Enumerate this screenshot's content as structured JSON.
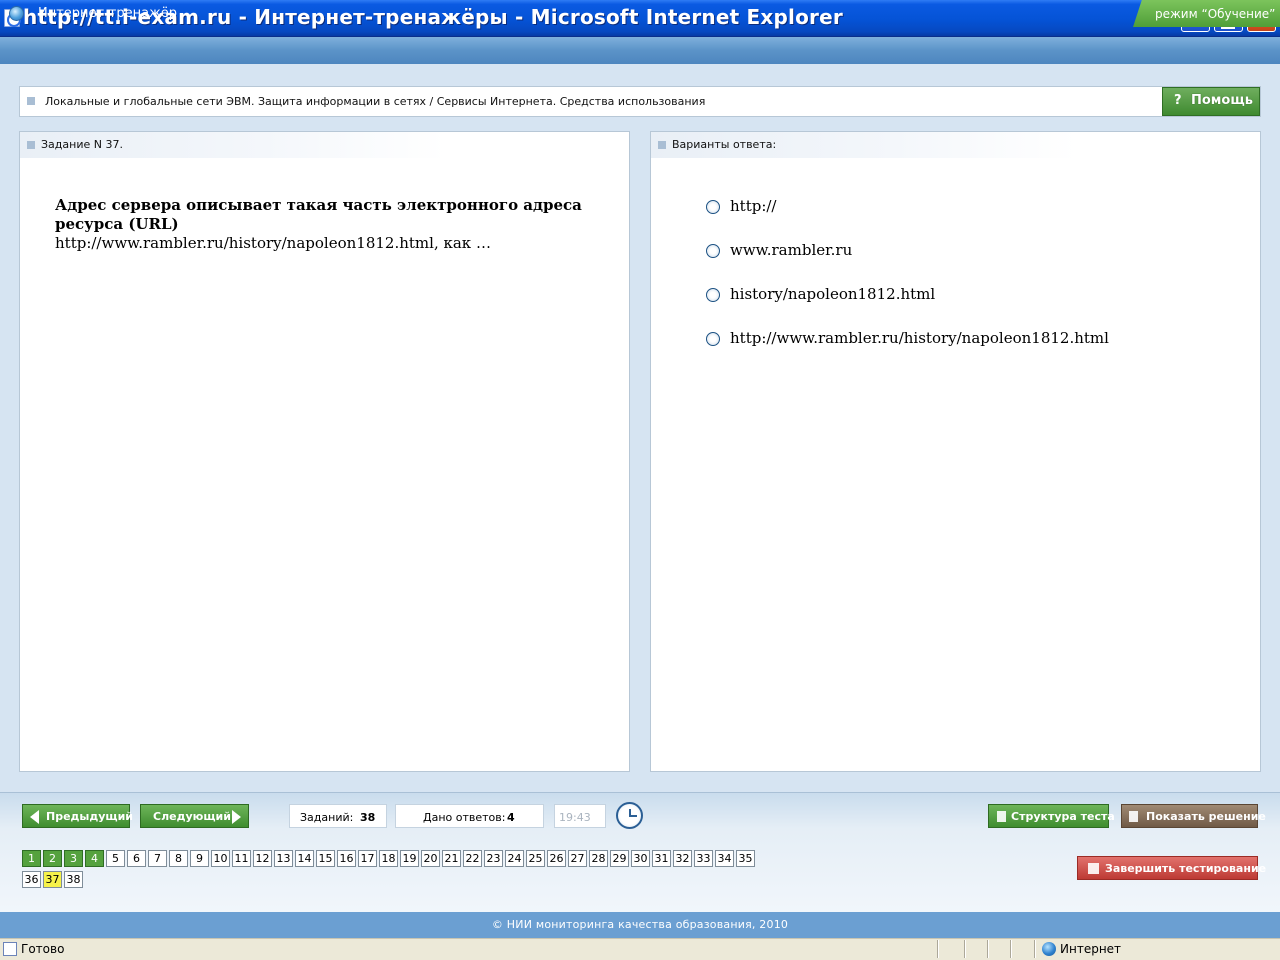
{
  "window": {
    "title": "http://tt.i-exam.ru - Интернет-тренажёры - Microsoft Internet Explorer"
  },
  "header": {
    "app_name": "Интернет-тренажёр",
    "mode": "режим “Обучение”"
  },
  "topic": {
    "text": "Локальные и глобальные сети ЭВМ. Защита информации в сетях / Сервисы Интернета. Средства использования",
    "help_label": "Помощь",
    "help_icon": "?"
  },
  "task": {
    "title": "Задание N 37.",
    "question_line1": "Адрес сервера описывает такая часть электронного адреса ресурса (URL)",
    "question_line2": "http://www.rambler.ru/history/napoleon1812.html, как …"
  },
  "answers": {
    "title": "Варианты ответа:",
    "options": [
      "http://",
      "www.rambler.ru",
      "history/napoleon1812.html",
      "http://www.rambler.ru/history/napoleon1812.html"
    ]
  },
  "controls": {
    "prev_label": "Предыдущий",
    "next_label": "Следующий",
    "tasks_label": "Заданий:",
    "tasks_count": "38",
    "answered_label": "Дано ответов:",
    "answered_count": "4",
    "timer": "19:43",
    "structure_label": "Структура теста",
    "solution_label": "Показать решение",
    "finish_label": "Завершить тестирование"
  },
  "question_numbers": {
    "items": [
      "1",
      "2",
      "3",
      "4",
      "5",
      "6",
      "7",
      "8",
      "9",
      "10",
      "11",
      "12",
      "13",
      "14",
      "15",
      "16",
      "17",
      "18",
      "19",
      "20",
      "21",
      "22",
      "23",
      "24",
      "25",
      "26",
      "27",
      "28",
      "29",
      "30",
      "31",
      "32",
      "33",
      "34",
      "35",
      "36",
      "37",
      "38"
    ],
    "answered": [
      "1",
      "2",
      "3",
      "4"
    ],
    "current": "37"
  },
  "footer": {
    "copyright": "© НИИ мониторинга качества образования, 2010"
  },
  "statusbar": {
    "status": "Готово",
    "zone": "Интернет"
  },
  "colors": {
    "accent_green": "#4f9e38",
    "title_blue": "#0553d6",
    "current_yellow": "#f6f24a"
  }
}
